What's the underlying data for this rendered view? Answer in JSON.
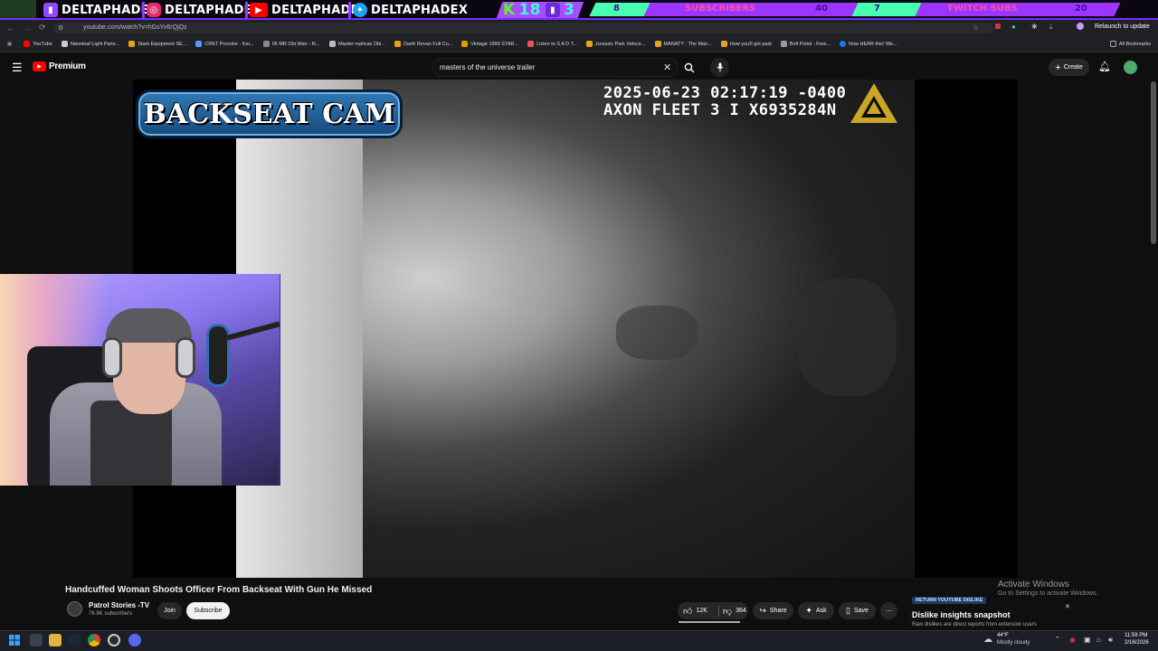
{
  "overlay": {
    "socials": [
      {
        "name": "DELTAPHADE",
        "icon": "twitch-icon",
        "color": "#9146ff"
      },
      {
        "name": "DELTAPHADE",
        "icon": "instagram-icon",
        "color": "#e1306c"
      },
      {
        "name": "DELTAPHADE",
        "icon": "youtube-icon",
        "color": "#ff0000"
      },
      {
        "name": "DELTAPHADEX",
        "icon": "twitter-icon",
        "color": "#1da1f2"
      }
    ],
    "kick_count": "18",
    "twitch_count": "3",
    "goals": [
      {
        "current": "8",
        "label": "SUBSCRIBERS",
        "target": "40"
      },
      {
        "current": "7",
        "label": "TWITCH SUBS",
        "target": "20"
      }
    ]
  },
  "browser": {
    "url": "youtube.com/watch?v=hGsYv6rQjQz",
    "relaunch": "Relaunch to update",
    "all_bookmarks": "All Bookmarks",
    "bookmarks": [
      "YouTube",
      "Nanoleaf Light Pane...",
      "Stark Equipment SE...",
      "CRKT Provoke - Kar...",
      "06 MR Obi Wan - Ki...",
      "Master replicas Obi...",
      "Darth Revan Full Co...",
      "Vintage 1999 STAR...",
      "Listen to S A D T...",
      "Jurassic Park Veloce...",
      "MANATY : The Man...",
      "How you'll get paid",
      "Bolt Pistol - Free...",
      "Now HEAR this! We..."
    ]
  },
  "youtube": {
    "logo": "Premium",
    "search_value": "masters of the universe trailer",
    "create_label": "Create",
    "video": {
      "timestamp": "2025-06-23 02:17:19 -0400",
      "device": "AXON FLEET 3 I X6935284N",
      "banner": "BACKSEAT CAM"
    },
    "title": "Handcuffed Woman Shoots Officer From Backseat With Gun He Missed",
    "channel": "Patrol Stories -TV",
    "subscribers": "76.9K subscribers",
    "join_label": "Join",
    "subscribe_label": "Subscribe",
    "likes": "12K",
    "dislikes": "364",
    "share_label": "Share",
    "ask_label": "Ask",
    "save_label": "Save",
    "ryd": {
      "badge": "RETURN YOUTUBE DISLIKE",
      "title": "Dislike insights snapshot",
      "text": "Raw dislikes are direct reports from extension users"
    }
  },
  "watermark": {
    "title": "Activate Windows",
    "text": "Go to Settings to activate Windows."
  },
  "taskbar": {
    "weather_temp": "44°F",
    "weather_desc": "Mostly cloudy",
    "time": "11:59 PM",
    "date": "2/16/2026"
  }
}
